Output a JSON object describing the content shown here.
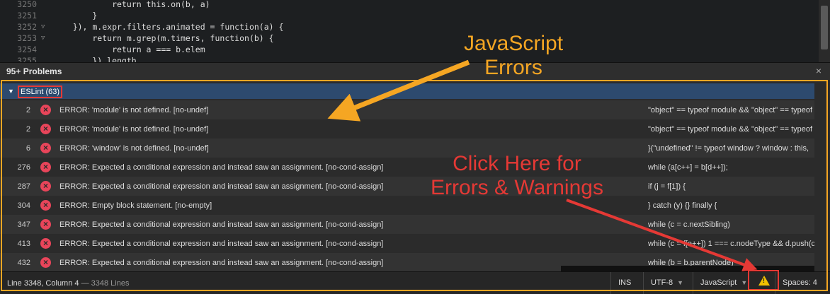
{
  "editor": {
    "lines": [
      {
        "num": "3250",
        "fold": "",
        "code": "            return this.on(b, a)"
      },
      {
        "num": "3251",
        "fold": "",
        "code": "        }"
      },
      {
        "num": "3252",
        "fold": "▽",
        "code": "    }), m.expr.filters.animated = function(a) {"
      },
      {
        "num": "3253",
        "fold": "▽",
        "code": "        return m.grep(m.timers, function(b) {"
      },
      {
        "num": "3254",
        "fold": "",
        "code": "            return a === b.elem"
      },
      {
        "num": "3255",
        "fold": "",
        "code": "        }).length"
      }
    ]
  },
  "panel": {
    "title": "95+ Problems",
    "close_icon": "×",
    "group_label": "ESLint (63)",
    "rows": [
      {
        "line": "2",
        "message": "ERROR: 'module' is not defined. [no-undef]",
        "code": "\"object\" == typeof module && \"object\" == typeof"
      },
      {
        "line": "2",
        "message": "ERROR: 'module' is not defined. [no-undef]",
        "code": "\"object\" == typeof module && \"object\" == typeof"
      },
      {
        "line": "6",
        "message": "ERROR: 'window' is not defined. [no-undef]",
        "code": "}(\"undefined\" != typeof window ? window : this,"
      },
      {
        "line": "276",
        "message": "ERROR: Expected a conditional expression and instead saw an assignment. [no-cond-assign]",
        "code": "while (a[c++] = b[d++]);"
      },
      {
        "line": "287",
        "message": "ERROR: Expected a conditional expression and instead saw an assignment. [no-cond-assign]",
        "code": "if (j = f[1]) {"
      },
      {
        "line": "304",
        "message": "ERROR: Empty block statement. [no-empty]",
        "code": "} catch (y) {} finally {"
      },
      {
        "line": "347",
        "message": "ERROR: Expected a conditional expression and instead saw an assignment. [no-cond-assign]",
        "code": "while (c = c.nextSibling)"
      },
      {
        "line": "413",
        "message": "ERROR: Expected a conditional expression and instead saw an assignment. [no-cond-assign]",
        "code": "while (c = f[e++]) 1 === c.nodeType && d.push(c)"
      },
      {
        "line": "432",
        "message": "ERROR: Expected a conditional expression and instead saw an assignment. [no-cond-assign]",
        "code": "while (b = b.parentNode)"
      }
    ]
  },
  "status": {
    "position": "Line 3348, Column 4",
    "lines": " — 3348 Lines",
    "ins": "INS",
    "encoding": "UTF-8",
    "language": "JavaScript",
    "spaces": "Spaces:  4",
    "warning_icon": "!"
  },
  "annotations": {
    "js_errors_line1": "JavaScript",
    "js_errors_line2": "Errors",
    "click_here_line1": "Click Here for",
    "click_here_line2": "Errors & Warnings"
  },
  "colors": {
    "orange_annotation": "#f5a623",
    "red_annotation": "#e53935",
    "error_icon": "#e8455a",
    "group_header": "#2d4a6e",
    "warning": "#f2c200"
  }
}
